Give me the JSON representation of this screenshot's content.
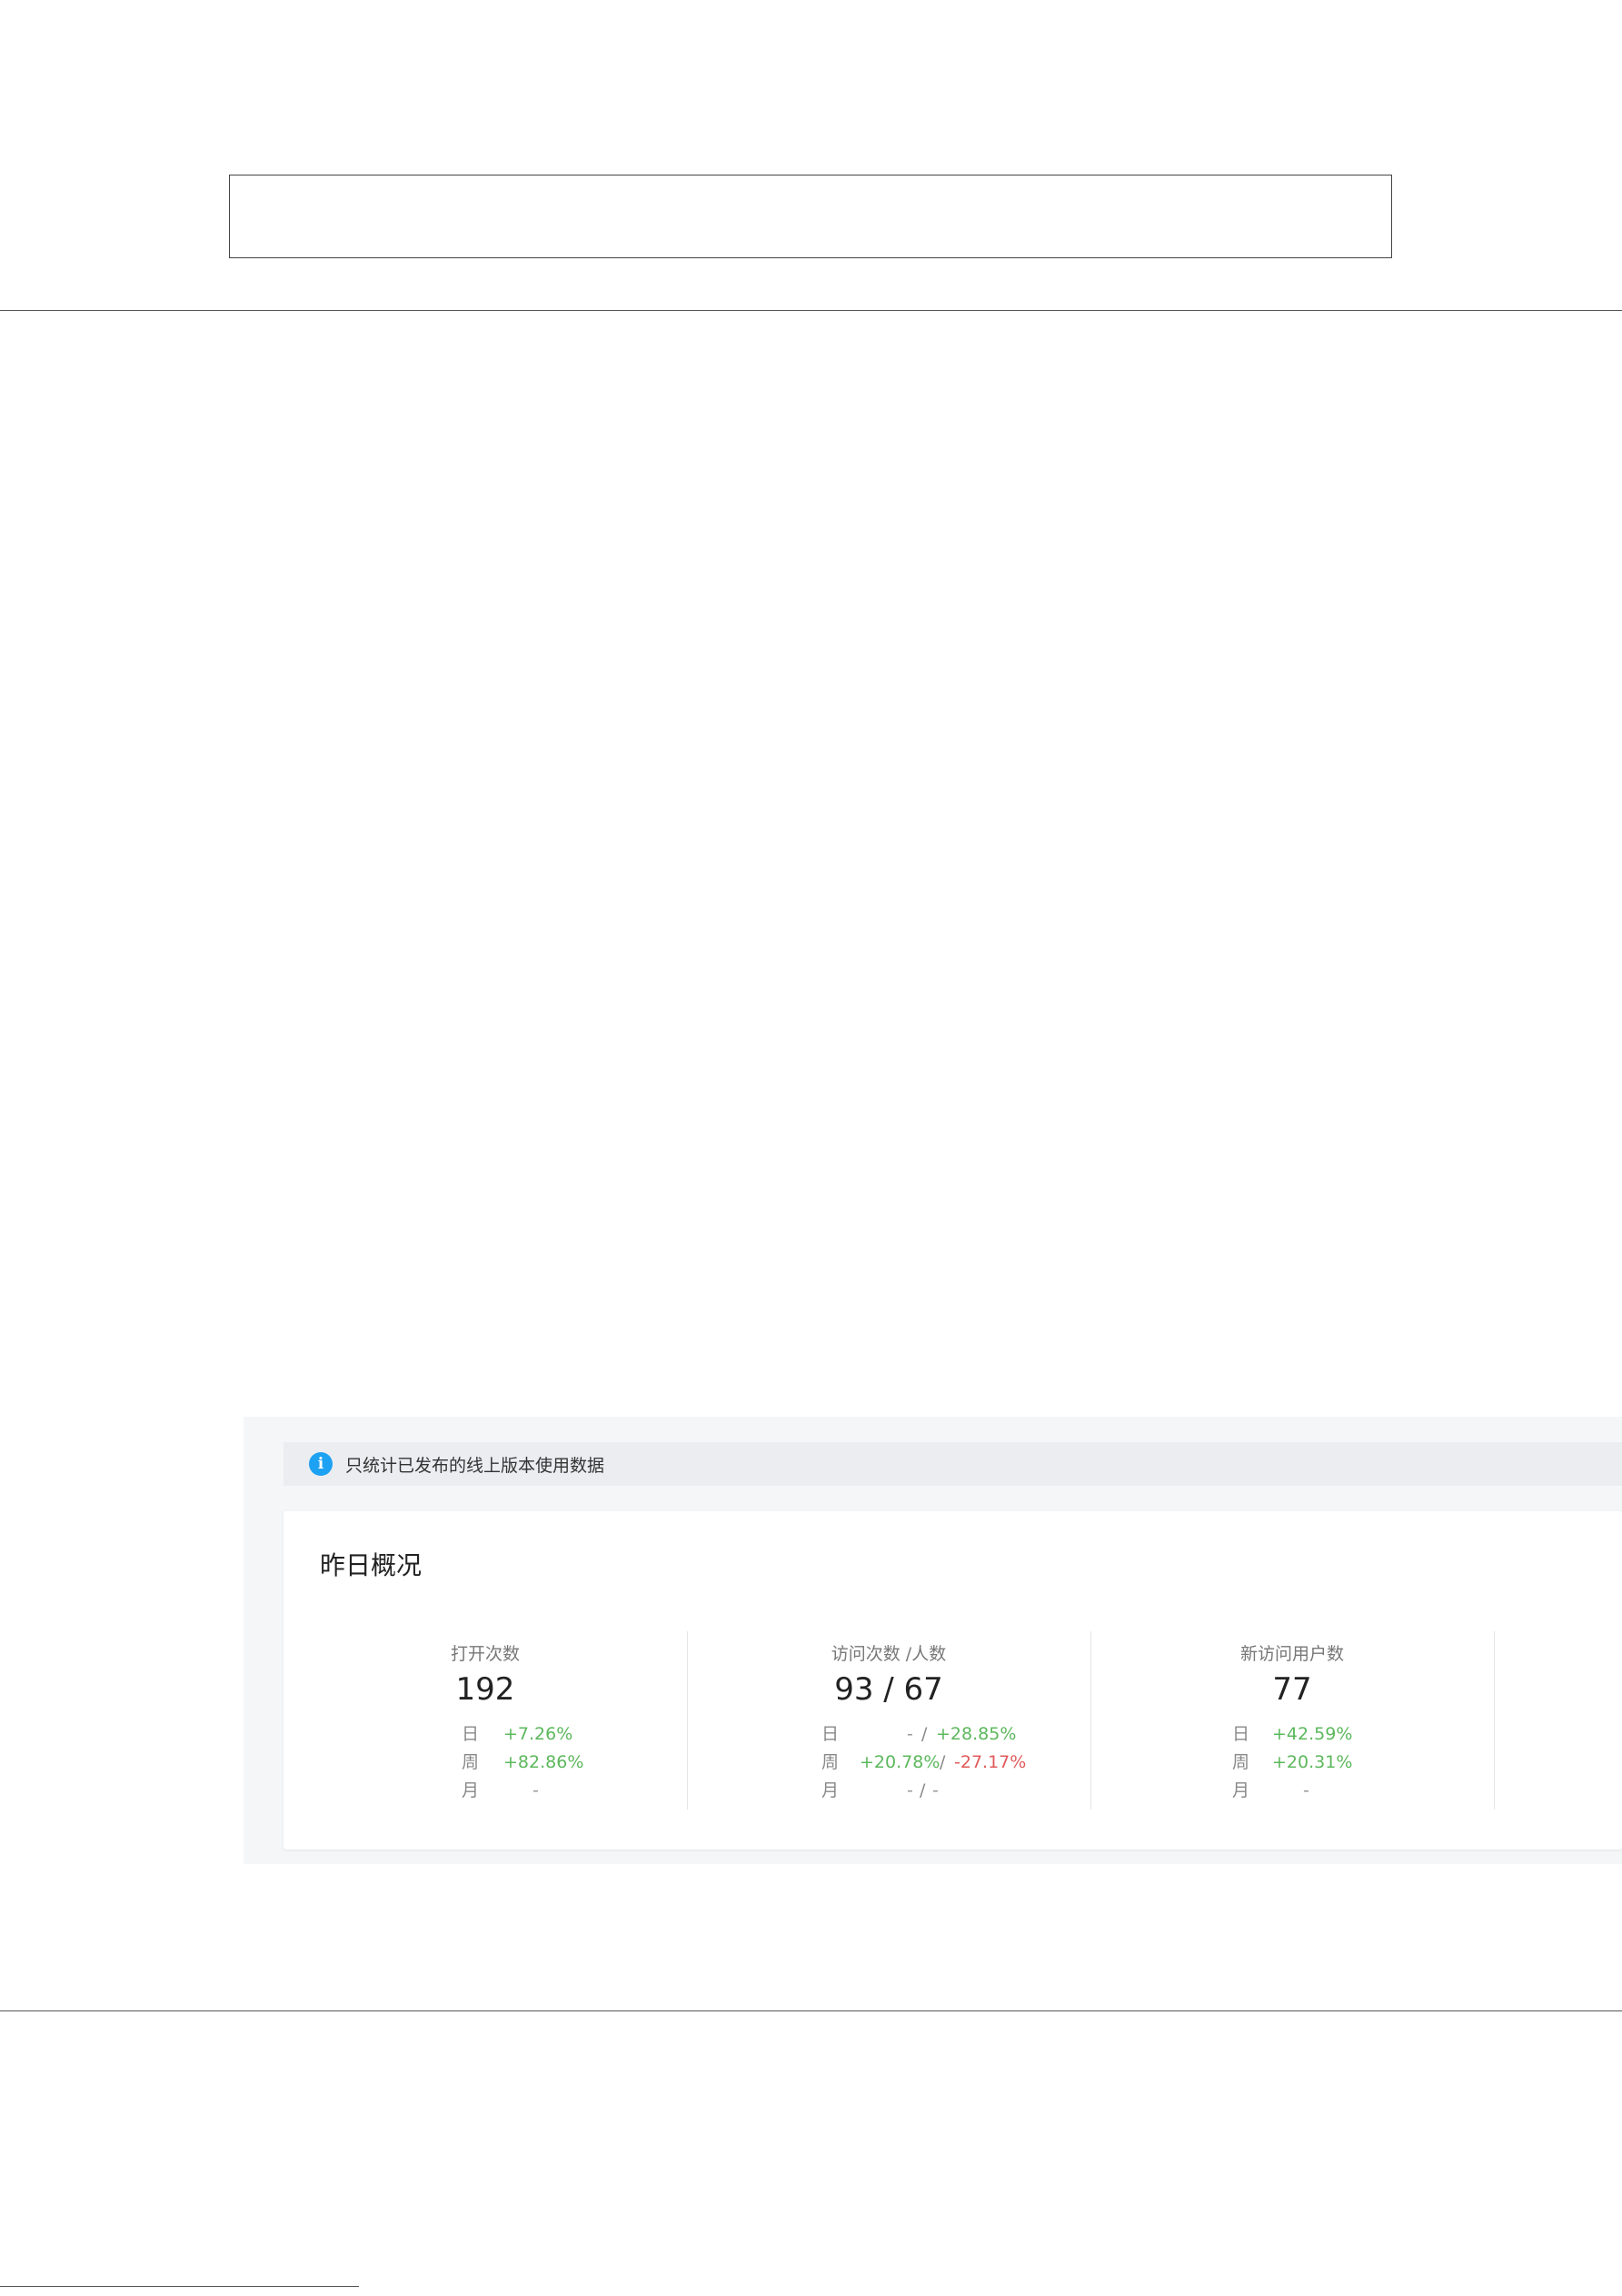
{
  "notice": {
    "text": "只统计已发布的线上版本使用数据"
  },
  "overview": {
    "title": "昨日概况",
    "metrics": [
      {
        "label": "打开次数",
        "value": "192",
        "rows": [
          {
            "key": "日",
            "parts": [
              "+7.26%"
            ]
          },
          {
            "key": "周",
            "parts": [
              "+82.86%"
            ]
          },
          {
            "key": "月",
            "parts": [
              "-"
            ]
          }
        ]
      },
      {
        "label": "访问次数 /人数",
        "value": "93 / 67",
        "rows": [
          {
            "key": "日",
            "parts": [
              "-",
              "/",
              "+28.85%"
            ]
          },
          {
            "key": "周",
            "parts": [
              "+20.78%",
              "/",
              "-27.17%"
            ]
          },
          {
            "key": "月",
            "parts": [
              "-",
              "/",
              "-"
            ]
          }
        ]
      },
      {
        "label": "新访问用户数",
        "value": "77",
        "rows": [
          {
            "key": "日",
            "parts": [
              "+42.59%"
            ]
          },
          {
            "key": "周",
            "parts": [
              "+20.31%"
            ]
          },
          {
            "key": "月",
            "parts": [
              "-"
            ]
          }
        ]
      }
    ]
  },
  "colors": {
    "positive": "#5cb85c",
    "negative": "#e05a5a",
    "info": "#1da1f2"
  }
}
